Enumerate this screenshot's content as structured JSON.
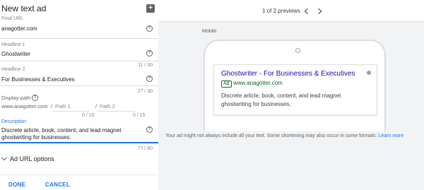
{
  "editor": {
    "title": "New text ad",
    "add_icon": "add-icon",
    "final_url": {
      "label": "Final URL",
      "value": "anagotter.com"
    },
    "headline1": {
      "label": "Headline 1",
      "value": "Ghostwriter",
      "counter": "11 / 30"
    },
    "headline2": {
      "label": "Headline 2",
      "value": "For Businesses & Executives",
      "counter": "27 / 30"
    },
    "display_path": {
      "label": "Display path",
      "domain": "www.anagotter.com",
      "sep1": "/",
      "path1_placeholder": "Path 1",
      "sep2": "/",
      "path2_placeholder": "Path 2",
      "path1_counter": "0 / 15",
      "path2_counter": "0 / 15"
    },
    "description": {
      "label": "Description",
      "value": "Discrete article, book, content, and lead magnet ghostwriting for businesses.",
      "counter": "77 / 80"
    },
    "ad_url_options": "Ad URL options",
    "done": "DONE",
    "cancel": "CANCEL"
  },
  "preview": {
    "count": "1 of 2 previews",
    "device_label": "Mobile",
    "ad": {
      "headline": "Ghostwriter - For Businesses & Executives",
      "badge": "Ad",
      "url": "www.anagotter.com",
      "description": "Discrete article, book, content, and lead magnet ghostwriting for businesses."
    },
    "disclaimer": "Your ad might not always include all your text. Some shortening may also occur in some formats.",
    "learn_more": "Learn more"
  },
  "colors": {
    "accent": "#1a73e8",
    "ad_headline": "#1a0dab",
    "ad_url": "#0d652d",
    "preview_bg": "#f1f3f4"
  }
}
